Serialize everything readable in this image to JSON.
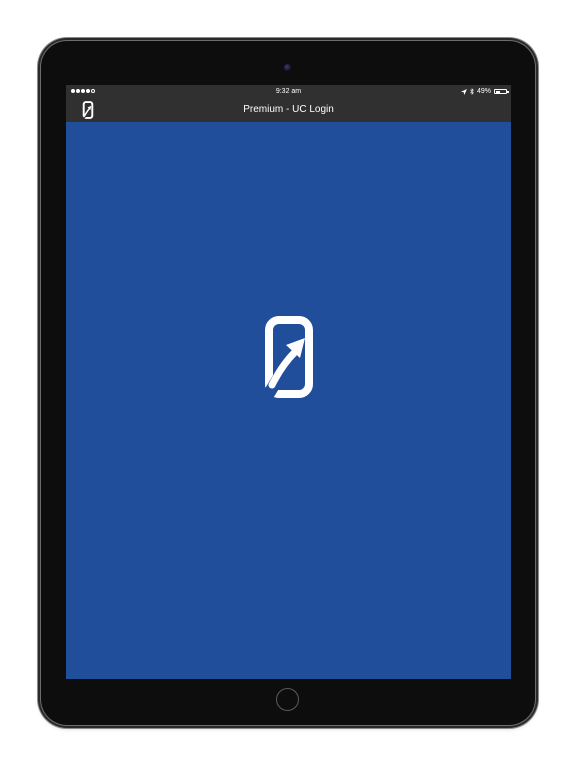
{
  "status_bar": {
    "time": "9:32 am",
    "battery_percent": "49%",
    "battery_level": 0.49,
    "signal_bars": 4,
    "signal_total": 5,
    "icons": [
      "location-arrow-icon",
      "bluetooth-icon",
      "battery-icon"
    ]
  },
  "nav_bar": {
    "title": "Premium - UC Login",
    "logo_icon": "app-logo-icon"
  },
  "main": {
    "splash_icon": "app-logo-icon"
  },
  "colors": {
    "screen_background": "#214e9b",
    "bar_background": "#303030",
    "device_frame": "#0d0d0e",
    "logo": "#ffffff"
  }
}
